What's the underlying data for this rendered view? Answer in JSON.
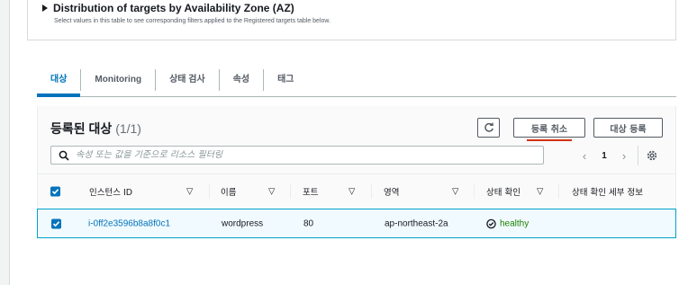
{
  "az": {
    "title": "Distribution of targets by Availability Zone (AZ)",
    "description": "Select values in this table to see corresponding filters applied to the Registered targets table below."
  },
  "tabs": [
    {
      "label": "대상",
      "active": true
    },
    {
      "label": "Monitoring",
      "active": false
    },
    {
      "label": "상태 검사",
      "active": false
    },
    {
      "label": "속성",
      "active": false
    },
    {
      "label": "태그",
      "active": false
    }
  ],
  "targets": {
    "title": "등록된 대상",
    "count": "(1/1)",
    "buttons": {
      "deregister": "등록 취소",
      "register": "대상 등록"
    },
    "search_placeholder": "속성 또는 값을 기준으로 리소스 필터링",
    "page": "1"
  },
  "table": {
    "columns": [
      "인스턴스 ID",
      "이름",
      "포트",
      "영역",
      "상태 확인",
      "상태 확인 세부 정보"
    ],
    "rows": [
      {
        "selected": true,
        "instance_id": "i-0ff2e3596b8a8f0c1",
        "name": "wordpress",
        "port": "80",
        "zone": "ap-northeast-2a",
        "health": "healthy",
        "health_details": ""
      }
    ]
  },
  "colors": {
    "accent": "#0073bb",
    "healthy": "#1d8102",
    "highlight_border": "#00a1c9",
    "underline": "#d13212"
  }
}
